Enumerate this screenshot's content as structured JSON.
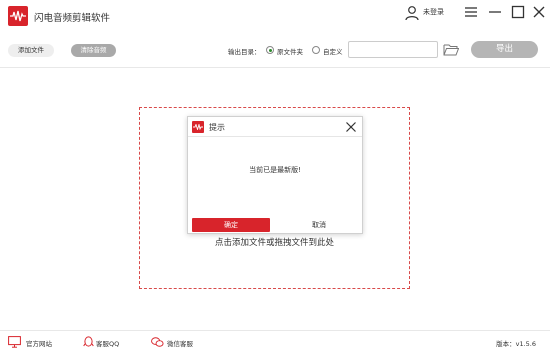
{
  "app": {
    "title": "闪电音频剪辑软件",
    "login_text": "未登录",
    "brand_color": "#d8242b"
  },
  "toolbar": {
    "add_file_label": "添加文件",
    "clear_audio_label": "清除音频",
    "output_dir_label": "输出目录：",
    "radio_source_folder_label": "原文件夹",
    "radio_custom_label": "自定义",
    "selected_output": "原文件夹",
    "path_value": "",
    "export_label": "导出"
  },
  "main": {
    "drop_hint": "点击添加文件或拖拽文件到此处"
  },
  "dialog": {
    "title": "提示",
    "message": "当前已是最新版!",
    "ok_label": "确定",
    "cancel_label": "取消"
  },
  "footer": {
    "website_label": "官方网站",
    "qq_label": "客服QQ",
    "wechat_label": "微信客服",
    "version_text": "版本：v1.5.6"
  },
  "icons": {
    "logo": "waveform-logo-icon",
    "user": "user-icon",
    "menu": "menu-icon",
    "minimize": "minimize-icon",
    "maximize": "maximize-icon",
    "close": "close-icon",
    "folder": "folder-icon",
    "website": "monitor-icon",
    "qq": "qq-penguin-icon",
    "wechat": "wechat-icon"
  }
}
